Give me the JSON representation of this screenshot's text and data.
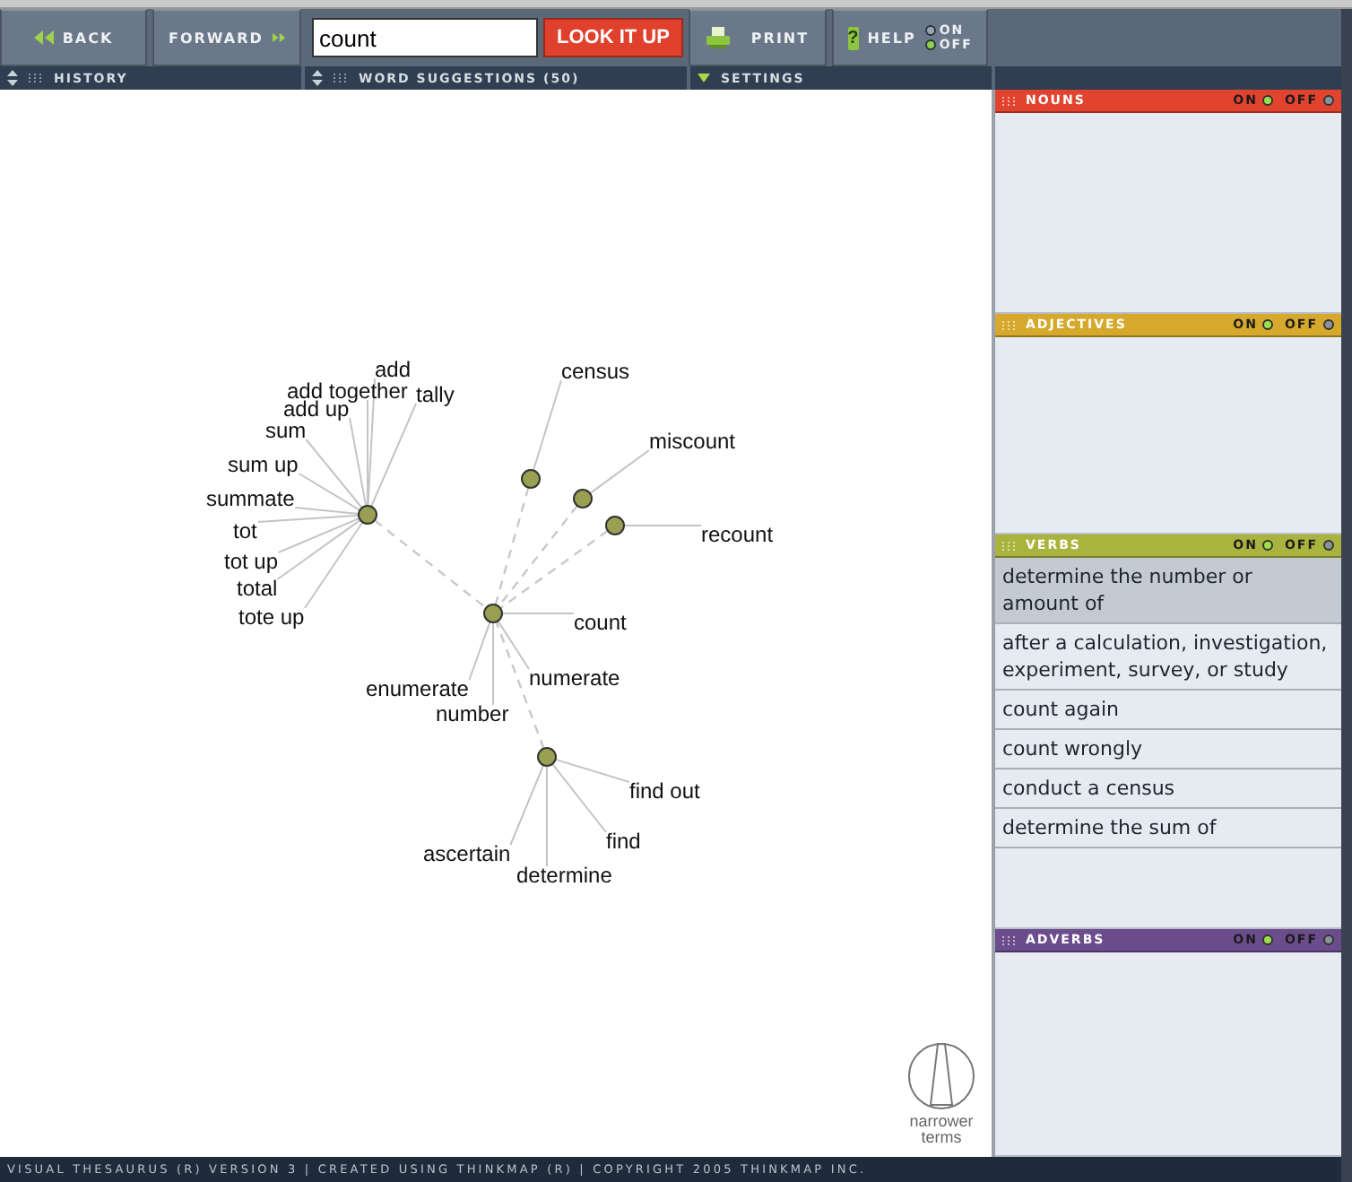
{
  "toolbar": {
    "back": "BACK",
    "forward": "FORWARD",
    "search": {
      "value": "count"
    },
    "lookup": "LOOK IT UP",
    "print": "PRINT",
    "help": {
      "icon": "?",
      "label": "HELP",
      "on_label": "ON",
      "off_label": "OFF",
      "on": false
    }
  },
  "subbar": [
    {
      "kind": "sorter",
      "label": "HISTORY"
    },
    {
      "kind": "sorter",
      "label": "WORD SUGGESTIONS (50)"
    },
    {
      "kind": "dropdown",
      "label": "SETTINGS"
    }
  ],
  "graph": {
    "nodes": [
      {
        "kind": "related",
        "words": [
          "add",
          "add together",
          "tally",
          "add up",
          "sum",
          "sum up",
          "summate",
          "tot",
          "tot up",
          "total",
          "tote up"
        ]
      },
      {
        "kind": "related",
        "words": [
          "census"
        ]
      },
      {
        "kind": "related",
        "words": [
          "miscount"
        ]
      },
      {
        "kind": "related",
        "words": [
          "recount"
        ]
      },
      {
        "kind": "center",
        "words": [
          "count",
          "numerate",
          "enumerate",
          "number"
        ]
      },
      {
        "kind": "related",
        "words": [
          "find out",
          "find",
          "ascertain",
          "determine"
        ]
      }
    ],
    "legend": "narrower terms"
  },
  "panels": [
    {
      "title": "NOUNS",
      "color": "#e2432f",
      "on_label": "ON",
      "off_label": "OFF",
      "on": true
    },
    {
      "title": "ADJECTIVES",
      "color": "#d6a92c",
      "on_label": "ON",
      "off_label": "OFF",
      "on": true
    },
    {
      "title": "VERBS",
      "color": "#a9b43e",
      "on_label": "ON",
      "off_label": "OFF",
      "on": true,
      "definitions": [
        {
          "text": "determine the number or amount of",
          "selected": true
        },
        {
          "text": "after a calculation, investigation, experiment, survey, or study",
          "selected": false
        },
        {
          "text": "count again",
          "selected": false
        },
        {
          "text": "count wrongly",
          "selected": false
        },
        {
          "text": "conduct a census",
          "selected": false
        },
        {
          "text": "determine the sum of",
          "selected": false
        }
      ]
    },
    {
      "title": "ADVERBS",
      "color": "#6b4c8c",
      "on_label": "ON",
      "off_label": "OFF",
      "on": true
    }
  ],
  "footer": "VISUAL THESAURUS (R) VERSION 3 | CREATED USING THINKMAP (R) | COPYRIGHT 2005 THINKMAP INC."
}
